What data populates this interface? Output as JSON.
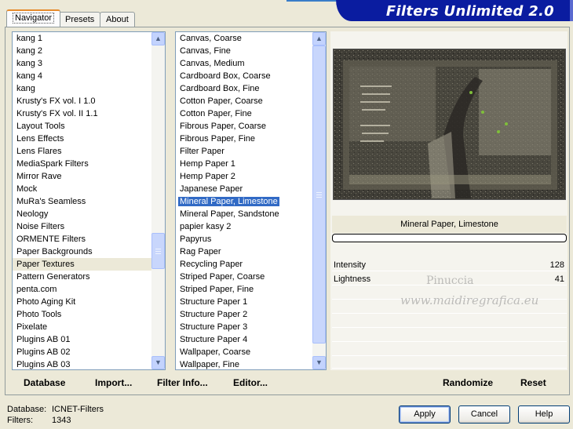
{
  "tabs": [
    {
      "label": "Navigator",
      "active": true
    },
    {
      "label": "Presets",
      "active": false
    },
    {
      "label": "About",
      "active": false
    }
  ],
  "banner": {
    "title": "Filters Unlimited 2.0"
  },
  "categories": {
    "items": [
      "kang 1",
      "kang 2",
      "kang 3",
      "kang 4",
      "kang",
      "Krusty's FX vol. I 1.0",
      "Krusty's FX vol. II 1.1",
      "Layout Tools",
      "Lens Effects",
      "Lens Flares",
      "MediaSpark Filters",
      "Mirror Rave",
      "Mock",
      "MuRa's Seamless",
      "Neology",
      "Noise Filters",
      "ORMENTE Filters",
      "Paper Backgrounds",
      "Paper Textures",
      "Pattern Generators",
      "penta.com",
      "Photo Aging Kit",
      "Photo Tools",
      "Pixelate",
      "Plugins AB 01",
      "Plugins AB 02",
      "Plugins AB 03"
    ],
    "selected": "Paper Textures",
    "scroll_up": "▲",
    "scroll_down": "▼"
  },
  "filters": {
    "items": [
      "Canvas, Coarse",
      "Canvas, Fine",
      "Canvas, Medium",
      "Cardboard Box, Coarse",
      "Cardboard Box, Fine",
      "Cotton Paper, Coarse",
      "Cotton Paper, Fine",
      "Fibrous Paper, Coarse",
      "Fibrous Paper, Fine",
      "Filter Paper",
      "Hemp Paper 1",
      "Hemp Paper 2",
      "Japanese Paper",
      "Mineral Paper, Limestone",
      "Mineral Paper, Sandstone",
      "papier kasy 2",
      "Papyrus",
      "Rag Paper",
      "Recycling Paper",
      "Striped Paper, Coarse",
      "Striped Paper, Fine",
      "Structure Paper 1",
      "Structure Paper 2",
      "Structure Paper 3",
      "Structure Paper 4",
      "Wallpaper, Coarse",
      "Wallpaper, Fine"
    ],
    "selected": "Mineral Paper, Limestone",
    "scroll_up": "▲",
    "scroll_down": "▼"
  },
  "bottom_links": {
    "database": "Database",
    "import": "Import...",
    "filter_info": "Filter Info...",
    "editor": "Editor..."
  },
  "preview": {
    "filter_name": "Mineral Paper, Limestone",
    "progress": 0
  },
  "params": [
    {
      "label": "Intensity",
      "value": "128"
    },
    {
      "label": "Lightness",
      "value": "41"
    }
  ],
  "watermark": {
    "line1": "Pinuccia",
    "line2": "www.maidiregrafica.eu"
  },
  "right_buttons": {
    "randomize": "Randomize",
    "reset": "Reset"
  },
  "status": {
    "database_label": "Database:",
    "database_value": "ICNET-Filters",
    "filters_label": "Filters:",
    "filters_value": "1343"
  },
  "dialog_buttons": {
    "apply": "Apply",
    "cancel": "Cancel",
    "help": "Help"
  },
  "colors": {
    "banner": "#0a1ca0",
    "selection": "#316ac5",
    "face": "#ece9d8"
  }
}
